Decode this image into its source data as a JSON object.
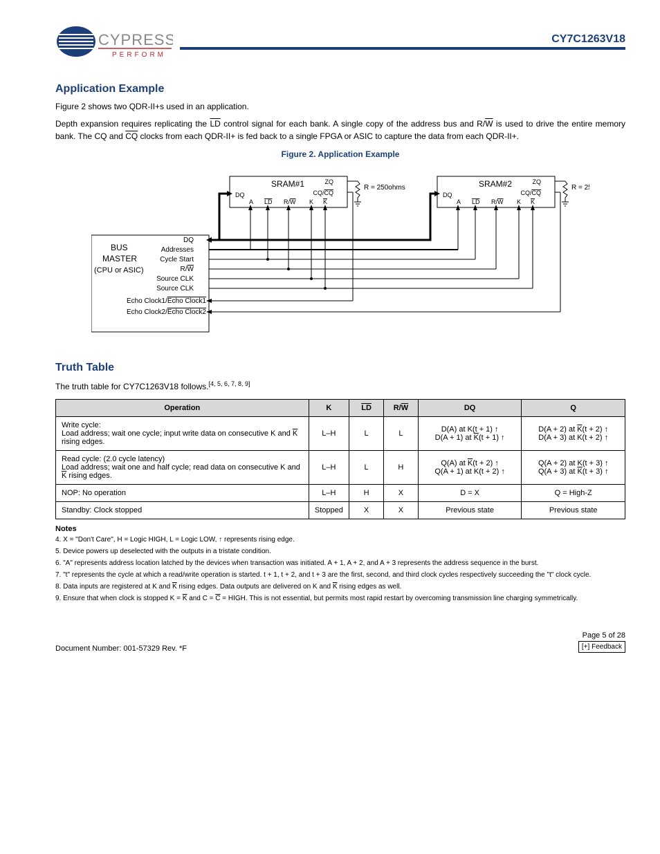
{
  "header": {
    "company": "CYPRESS",
    "tagline": "P E R F O R M",
    "part_number": "CY7C1263V18"
  },
  "section1": {
    "title": "Application Example",
    "figure_title": "Figure 2. Application Example",
    "para1_a": "Figure 2",
    "para1_b": " shows two QDR-II+s used in an application.",
    "para2": "Depth expansion requires replicating the LD control signal for each bank. A single copy of the address bus and R/W is used to drive the entire memory bank. The CQ and CQ clocks from each QDR-II+ is fed back to a single FPGA or ASIC to capture the data from each QDR-II+."
  },
  "diagram": {
    "sram1": "SRAM#1",
    "sram2": "SRAM#2",
    "labels": {
      "dq": "DQ",
      "a": "A",
      "ld": "LD",
      "rw": "R/W",
      "k": "K",
      "kbar": "K",
      "zq": "ZQ",
      "cqcq": "CQ/CQ",
      "r": "R = 250ohms"
    },
    "master": {
      "title1": "BUS",
      "title2": "MASTER",
      "title3": "(CPU or ASIC)",
      "dq": "DQ",
      "addr": "Addresses",
      "cycle": "Cycle Start",
      "rw": "R/W",
      "src1": "Source CLK",
      "src2": "Source CLK",
      "echo1": "Echo Clock1/Echo Clock1",
      "echo2": "Echo Clock2/Echo Clock2"
    }
  },
  "section2": {
    "title": "Truth Table",
    "intro": "The truth table for CY7C1263V18 follows."
  },
  "table": {
    "headers": {
      "op": "Operation",
      "k": "K",
      "ld": "LD",
      "rw": "R/W",
      "dq": "DQ",
      "q": "Q"
    },
    "rows": [
      {
        "op_line1": "Write cycle:",
        "op_line2": "Load address; wait one cycle; input write data on consecutive K and K rising edges.",
        "k": "L–H",
        "ld": "L",
        "rw": "L",
        "dq": "D(A) at K(t + 1) ↑\nD(A + 1) at K(t + 1) ↑",
        "q": "D(A + 2) at K(t + 2) ↑\nD(A + 3) at K(t + 2) ↑"
      },
      {
        "op_line1": "Read cycle: (2.0 cycle latency)",
        "op_line2": "Load address; wait one and half cycle; read data on consecutive K and K rising edges.",
        "k": "L–H",
        "ld": "L",
        "rw": "H",
        "dq": "Q(A) at K(t + 2) ↑\nQ(A + 1) at K(t + 2) ↑",
        "q": "Q(A + 2) at K(t + 3) ↑\nQ(A + 3) at K(t + 3) ↑"
      },
      {
        "op_line1": "NOP: No operation",
        "op_line2": "",
        "k": "L–H",
        "ld": "H",
        "rw": "X",
        "dq": "D = X",
        "q": "Q = High-Z"
      },
      {
        "op_line1": "Standby: Clock stopped",
        "op_line2": "",
        "k": "Stopped",
        "ld": "X",
        "rw": "X",
        "dq": "Previous state",
        "q": "Previous state"
      }
    ]
  },
  "notes": {
    "label": "Notes",
    "items": [
      "4. X = \"Don't Care\", H = Logic HIGH, L = Logic LOW, ↑ represents rising edge.",
      "5. Device powers up deselected with the outputs in a tristate condition.",
      "6. \"A\" represents address location latched by the devices when transaction was initiated. A + 1, A + 2, and A + 3 represents the address sequence in the burst.",
      "7. \"t\" represents the cycle at which a read/write operation is started. t + 1, t + 2, and t + 3 are the first, second, and third clock cycles respectively succeeding the \"t\" clock cycle.",
      "8. Data inputs are registered at K and K rising edges. Data outputs are delivered on K and K rising edges as well.",
      "9. Ensure that when clock is stopped K = K and C = C = HIGH. This is not essential, but permits most rapid restart by overcoming transmission line charging symmetrically."
    ]
  },
  "footer": {
    "doc": "Document Number: 001-57329 Rev. *F",
    "page": "Page 5 of 28",
    "rev": "[+] Feedback"
  },
  "refs": {
    "r456789": "[4, 5, 6, 7, 8, 9]",
    "r4": "[4]"
  }
}
